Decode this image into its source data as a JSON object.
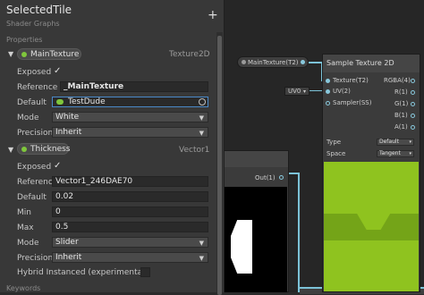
{
  "blackboard": {
    "title": "SelectedTile",
    "subtitle": "Shader Graphs",
    "add_label": "+",
    "properties_label": "Properties",
    "keywords_label": "Keywords"
  },
  "properties": [
    {
      "name": "MainTexture",
      "type": "Texture2D",
      "exposed_label": "Exposed",
      "reference_label": "Reference",
      "reference": "_MainTexture",
      "default_label": "Default",
      "default": "TestDude",
      "mode_label": "Mode",
      "mode": "White",
      "precision_label": "Precision",
      "precision": "Inherit"
    },
    {
      "name": "Thickness",
      "type": "Vector1",
      "exposed_label": "Exposed",
      "reference_label": "Reference",
      "reference": "Vector1_246DAE70",
      "default_label": "Default",
      "default": "0.02",
      "min_label": "Min",
      "min": "0",
      "max_label": "Max",
      "max": "0.5",
      "mode_label": "Mode",
      "mode": "Slider",
      "precision_label": "Precision",
      "precision": "Inherit",
      "hybrid_label": "Hybrid Instanced (experimental)"
    }
  ],
  "nodes": {
    "property_node": {
      "label": "MainTexture(T2)"
    },
    "uv_node": {
      "label": "UV0"
    },
    "output_node": {
      "port": "Out(1)"
    },
    "sample_texture": {
      "title": "Sample Texture 2D",
      "inputs": [
        "Texture(T2)",
        "UV(2)",
        "Sampler(SS)"
      ],
      "outputs": [
        "RGBA(4)",
        "R(1)",
        "G(1)",
        "B(1)",
        "A(1)"
      ],
      "type_label": "Type",
      "type_value": "Default",
      "space_label": "Space",
      "space_value": "Tangent"
    }
  },
  "colors": {
    "texture_preview": "#8fc31f",
    "port": "#88c8dc",
    "selection": "#4a89c8"
  }
}
